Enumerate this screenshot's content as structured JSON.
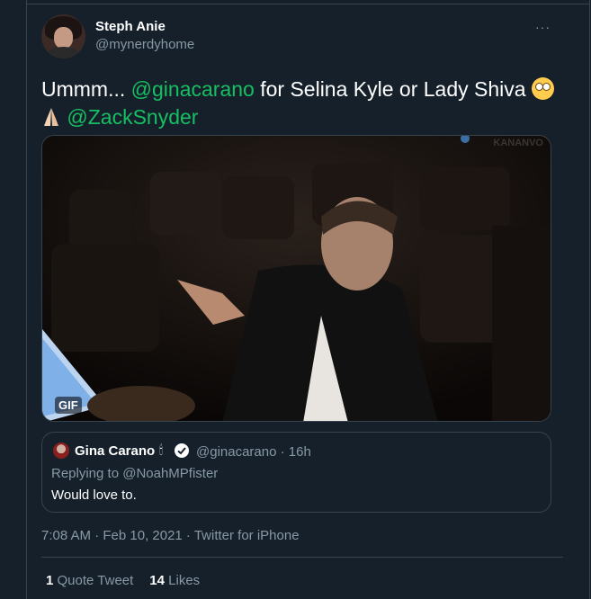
{
  "author": {
    "display_name": "Steph Anie",
    "handle": "@mynerdyhome"
  },
  "more_menu": "···",
  "tweet": {
    "text_before": "Ummm... ",
    "mention_1": "@ginacarano",
    "text_middle": " for Selina Kyle or Lady Shiva ",
    "mention_2": "@ZackSnyder",
    "emoji_1": "rolling-eyes-emoji",
    "emoji_2": "folded-hands-emoji"
  },
  "media": {
    "badge": "GIF",
    "watermark": "KANANVO"
  },
  "quote": {
    "name": "Gina Carano",
    "handle_time": "@ginacarano · 16h",
    "replying": "Replying to @NoahMPfister",
    "text": "Would love to."
  },
  "meta": {
    "timestamp": "7:08 AM · Feb 10, 2021 · Twitter for iPhone"
  },
  "stats": {
    "quote_count": "1",
    "quote_label": "Quote Tweet",
    "like_count": "14",
    "like_label": "Likes"
  },
  "colors": {
    "background": "#15202b",
    "border": "#38444d",
    "link": "#17bf63",
    "muted": "#8899a6"
  }
}
